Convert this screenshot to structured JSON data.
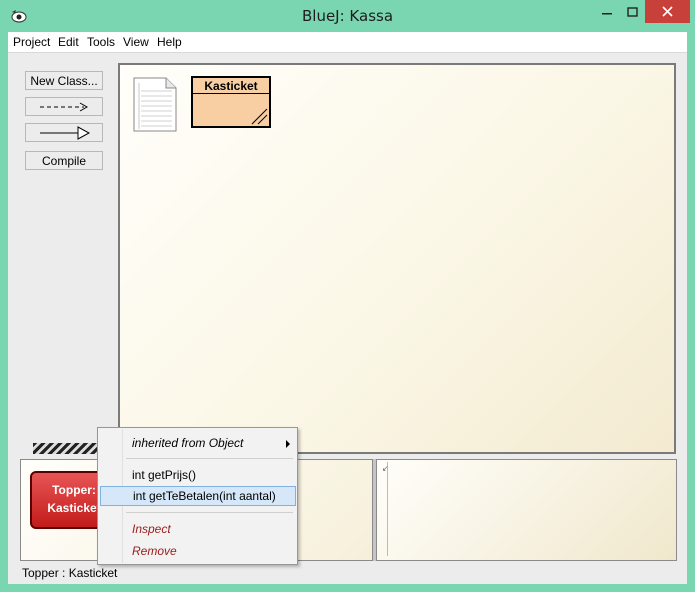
{
  "window": {
    "title": "BlueJ:  Kassa",
    "minimize_symbol": "—",
    "maximize_symbol": "□",
    "close_symbol": "✕"
  },
  "menubar": {
    "items": [
      "Project",
      "Edit",
      "Tools",
      "View",
      "Help"
    ]
  },
  "sidebar": {
    "new_class_label": "New Class...",
    "uses_arrow_icon": "dashed-arrow-icon",
    "inherits_arrow_icon": "inheritance-arrow-icon",
    "compile_label": "Compile"
  },
  "diagram": {
    "classes": [
      {
        "name": "Kasticket",
        "color": "#f7cfa3"
      }
    ],
    "readme_icon": "readme-note-icon"
  },
  "object_bench": {
    "objects": [
      {
        "name": "Topper:",
        "type": "Kasticket",
        "color": "#d32a2a"
      }
    ]
  },
  "context_menu": {
    "items": [
      {
        "label": "inherited from Object",
        "style": "italic",
        "submenu": true
      },
      {
        "label": "int getPrijs()",
        "style": "normal"
      },
      {
        "label": "int getTeBetalen(int aantal)",
        "style": "normal",
        "highlighted": true
      },
      {
        "label": "Inspect",
        "style": "italic-red"
      },
      {
        "label": "Remove",
        "style": "italic-red"
      }
    ]
  },
  "status_bar": {
    "text": "Topper : Kasticket"
  },
  "colors": {
    "window_frame": "#7ad6b0",
    "close_button": "#c7403a",
    "object_card": "#d32a2a",
    "class_box": "#f7cfa3",
    "highlight": "#d5e7f8"
  }
}
